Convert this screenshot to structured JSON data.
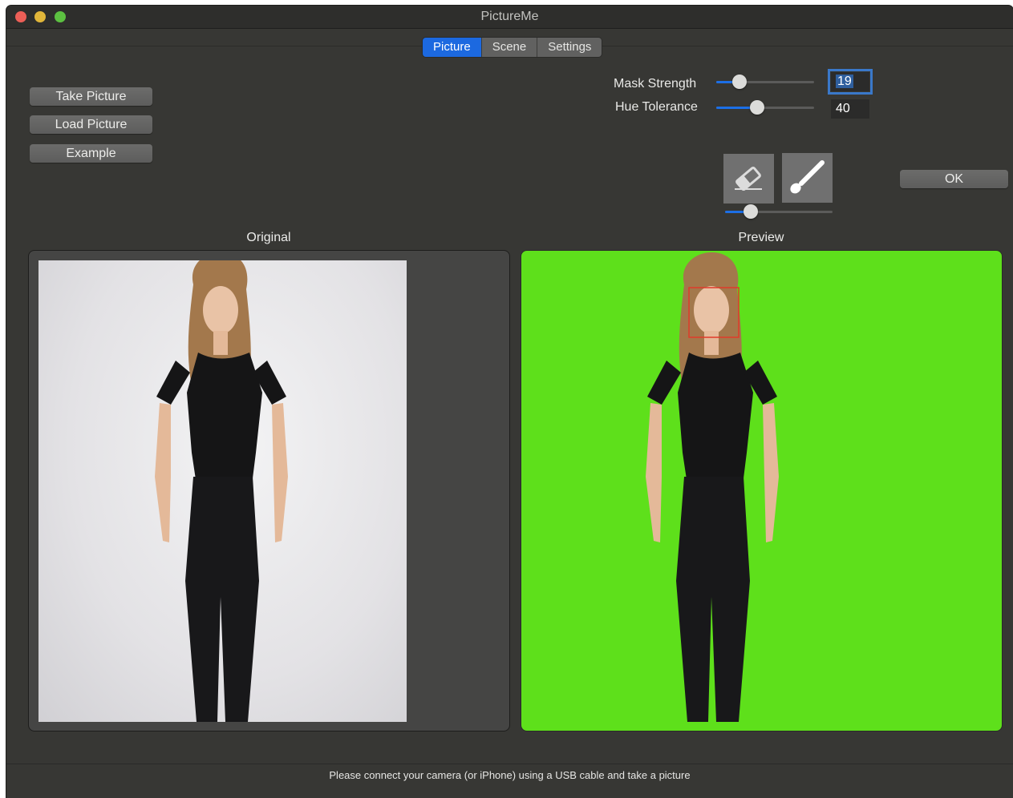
{
  "window": {
    "title": "PictureMe"
  },
  "tabs": [
    {
      "label": "Picture",
      "active": true
    },
    {
      "label": "Scene",
      "active": false
    },
    {
      "label": "Settings",
      "active": false
    }
  ],
  "actions": {
    "take_picture": "Take Picture",
    "load_picture": "Load Picture",
    "example": "Example",
    "ok": "OK"
  },
  "controls": {
    "mask_strength": {
      "label": "Mask Strength",
      "value": "19",
      "fraction": 0.24
    },
    "hue_tolerance": {
      "label": "Hue Tolerance",
      "value": "40",
      "fraction": 0.42
    },
    "brush_size": {
      "fraction": 0.24
    }
  },
  "tools": [
    {
      "name": "eraser-icon"
    },
    {
      "name": "brush-icon"
    }
  ],
  "panes": {
    "original_label": "Original",
    "preview_label": "Preview"
  },
  "colors": {
    "accent": "#1c69e0",
    "green_screen": "#5ee01b",
    "face_box": "#e03a2a"
  },
  "status": "Please connect your camera (or iPhone) using a USB cable and take a picture"
}
